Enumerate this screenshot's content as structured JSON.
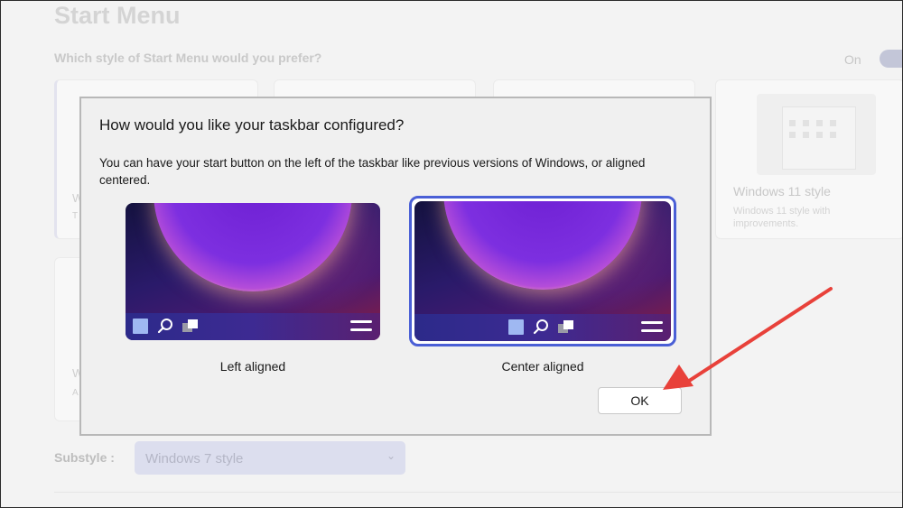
{
  "background": {
    "title": "Start Menu",
    "question": "Which style of Start Menu would you prefer?",
    "toggle_label": "On",
    "card_fragments": {
      "w1": "W",
      "t1": "T",
      "w2": "W",
      "a2": "A"
    },
    "windows11_card": {
      "title": "Windows 11 style",
      "description": "Windows 11 style with improvements."
    },
    "substyle_label": "Substyle :",
    "substyle_value": "Windows 7 style"
  },
  "dialog": {
    "title": "How would you like your taskbar configured?",
    "description": "You can have your start button on the left of the taskbar like previous versions of Windows, or aligned centered.",
    "options": [
      {
        "label": "Left aligned",
        "selected": false
      },
      {
        "label": "Center aligned",
        "selected": true
      }
    ],
    "ok_label": "OK"
  },
  "colors": {
    "selection_border": "#4a5fd6",
    "annotation_arrow": "#e8413a"
  },
  "icons": {
    "start": "windows-start-icon",
    "search": "search-icon",
    "task_view": "task-view-icon",
    "menu": "hamburger-menu-icon"
  }
}
